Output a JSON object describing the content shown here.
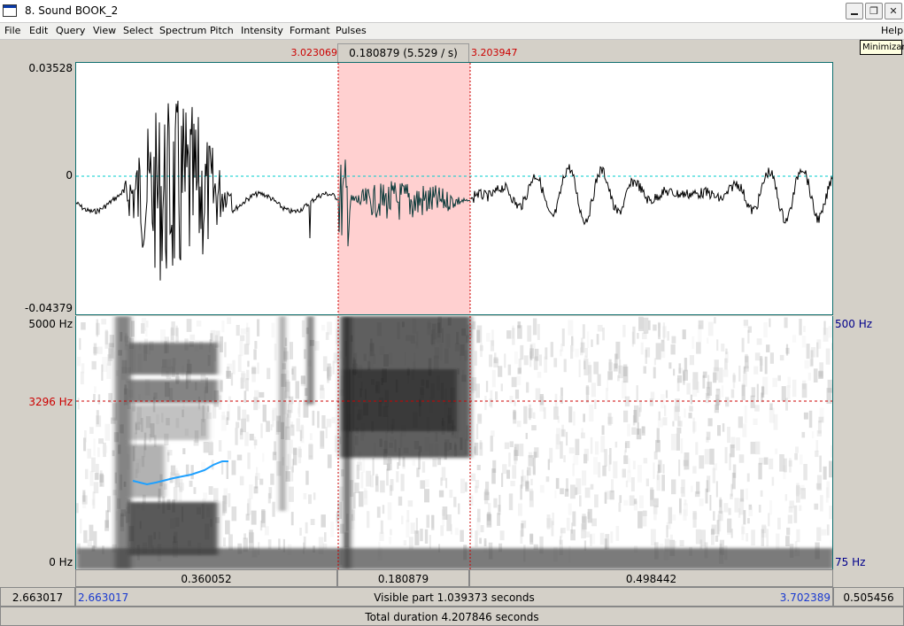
{
  "window": {
    "title": "8. Sound BOOK_2",
    "minimize_tooltip": "Minimizar",
    "icons": [
      "window-app-icon",
      "minimize-icon",
      "restore-icon",
      "close-icon"
    ]
  },
  "menu": {
    "items": [
      "File",
      "Edit",
      "Query",
      "View",
      "Select",
      "Spectrum",
      "Pitch",
      "Intensity",
      "Formant",
      "Pulses"
    ],
    "help": "Help"
  },
  "selection": {
    "start": "3.023069",
    "duration": "0.180879 (5.529 / s)",
    "end": "3.203947"
  },
  "waveform": {
    "ymax": "0.03528",
    "zero": "0",
    "ymin": "-0.04379"
  },
  "spectrogram": {
    "ymax": "5000 Hz",
    "cursor_freq": "3296 Hz",
    "ymin": "0 Hz",
    "pitch_max": "500 Hz",
    "pitch_min": "75 Hz"
  },
  "segments": {
    "left": "0.360052",
    "middle": "0.180879",
    "right": "0.498442"
  },
  "visible": {
    "window_start": "2.663017",
    "view_start": "2.663017",
    "label": "Visible part 1.039373 seconds",
    "view_end": "3.702389",
    "remaining": "0.505456"
  },
  "total": {
    "label": "Total duration 4.207846 seconds"
  },
  "colors": {
    "selection_fill": "#ffd0d0",
    "selection_lines": "#cc0000",
    "axis_frame": "#0e6e6e",
    "zero_line": "#00cccc",
    "pitch_track": "#1ea0ff"
  }
}
